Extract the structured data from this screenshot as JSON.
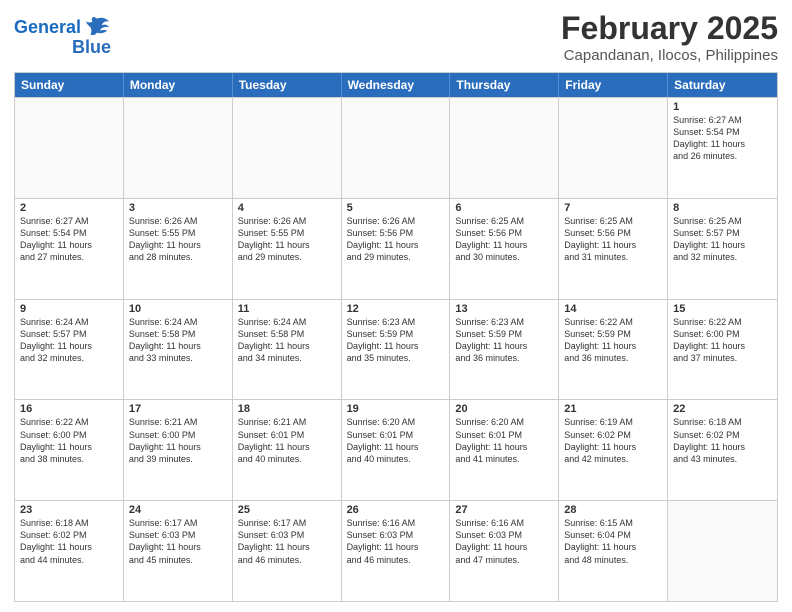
{
  "logo": {
    "line1": "General",
    "line2": "Blue"
  },
  "title": "February 2025",
  "location": "Capandanan, Ilocos, Philippines",
  "headers": [
    "Sunday",
    "Monday",
    "Tuesday",
    "Wednesday",
    "Thursday",
    "Friday",
    "Saturday"
  ],
  "weeks": [
    [
      {
        "day": "",
        "info": ""
      },
      {
        "day": "",
        "info": ""
      },
      {
        "day": "",
        "info": ""
      },
      {
        "day": "",
        "info": ""
      },
      {
        "day": "",
        "info": ""
      },
      {
        "day": "",
        "info": ""
      },
      {
        "day": "1",
        "info": "Sunrise: 6:27 AM\nSunset: 5:54 PM\nDaylight: 11 hours\nand 26 minutes."
      }
    ],
    [
      {
        "day": "2",
        "info": "Sunrise: 6:27 AM\nSunset: 5:54 PM\nDaylight: 11 hours\nand 27 minutes."
      },
      {
        "day": "3",
        "info": "Sunrise: 6:26 AM\nSunset: 5:55 PM\nDaylight: 11 hours\nand 28 minutes."
      },
      {
        "day": "4",
        "info": "Sunrise: 6:26 AM\nSunset: 5:55 PM\nDaylight: 11 hours\nand 29 minutes."
      },
      {
        "day": "5",
        "info": "Sunrise: 6:26 AM\nSunset: 5:56 PM\nDaylight: 11 hours\nand 29 minutes."
      },
      {
        "day": "6",
        "info": "Sunrise: 6:25 AM\nSunset: 5:56 PM\nDaylight: 11 hours\nand 30 minutes."
      },
      {
        "day": "7",
        "info": "Sunrise: 6:25 AM\nSunset: 5:56 PM\nDaylight: 11 hours\nand 31 minutes."
      },
      {
        "day": "8",
        "info": "Sunrise: 6:25 AM\nSunset: 5:57 PM\nDaylight: 11 hours\nand 32 minutes."
      }
    ],
    [
      {
        "day": "9",
        "info": "Sunrise: 6:24 AM\nSunset: 5:57 PM\nDaylight: 11 hours\nand 32 minutes."
      },
      {
        "day": "10",
        "info": "Sunrise: 6:24 AM\nSunset: 5:58 PM\nDaylight: 11 hours\nand 33 minutes."
      },
      {
        "day": "11",
        "info": "Sunrise: 6:24 AM\nSunset: 5:58 PM\nDaylight: 11 hours\nand 34 minutes."
      },
      {
        "day": "12",
        "info": "Sunrise: 6:23 AM\nSunset: 5:59 PM\nDaylight: 11 hours\nand 35 minutes."
      },
      {
        "day": "13",
        "info": "Sunrise: 6:23 AM\nSunset: 5:59 PM\nDaylight: 11 hours\nand 36 minutes."
      },
      {
        "day": "14",
        "info": "Sunrise: 6:22 AM\nSunset: 5:59 PM\nDaylight: 11 hours\nand 36 minutes."
      },
      {
        "day": "15",
        "info": "Sunrise: 6:22 AM\nSunset: 6:00 PM\nDaylight: 11 hours\nand 37 minutes."
      }
    ],
    [
      {
        "day": "16",
        "info": "Sunrise: 6:22 AM\nSunset: 6:00 PM\nDaylight: 11 hours\nand 38 minutes."
      },
      {
        "day": "17",
        "info": "Sunrise: 6:21 AM\nSunset: 6:00 PM\nDaylight: 11 hours\nand 39 minutes."
      },
      {
        "day": "18",
        "info": "Sunrise: 6:21 AM\nSunset: 6:01 PM\nDaylight: 11 hours\nand 40 minutes."
      },
      {
        "day": "19",
        "info": "Sunrise: 6:20 AM\nSunset: 6:01 PM\nDaylight: 11 hours\nand 40 minutes."
      },
      {
        "day": "20",
        "info": "Sunrise: 6:20 AM\nSunset: 6:01 PM\nDaylight: 11 hours\nand 41 minutes."
      },
      {
        "day": "21",
        "info": "Sunrise: 6:19 AM\nSunset: 6:02 PM\nDaylight: 11 hours\nand 42 minutes."
      },
      {
        "day": "22",
        "info": "Sunrise: 6:18 AM\nSunset: 6:02 PM\nDaylight: 11 hours\nand 43 minutes."
      }
    ],
    [
      {
        "day": "23",
        "info": "Sunrise: 6:18 AM\nSunset: 6:02 PM\nDaylight: 11 hours\nand 44 minutes."
      },
      {
        "day": "24",
        "info": "Sunrise: 6:17 AM\nSunset: 6:03 PM\nDaylight: 11 hours\nand 45 minutes."
      },
      {
        "day": "25",
        "info": "Sunrise: 6:17 AM\nSunset: 6:03 PM\nDaylight: 11 hours\nand 46 minutes."
      },
      {
        "day": "26",
        "info": "Sunrise: 6:16 AM\nSunset: 6:03 PM\nDaylight: 11 hours\nand 46 minutes."
      },
      {
        "day": "27",
        "info": "Sunrise: 6:16 AM\nSunset: 6:03 PM\nDaylight: 11 hours\nand 47 minutes."
      },
      {
        "day": "28",
        "info": "Sunrise: 6:15 AM\nSunset: 6:04 PM\nDaylight: 11 hours\nand 48 minutes."
      },
      {
        "day": "",
        "info": ""
      }
    ]
  ]
}
